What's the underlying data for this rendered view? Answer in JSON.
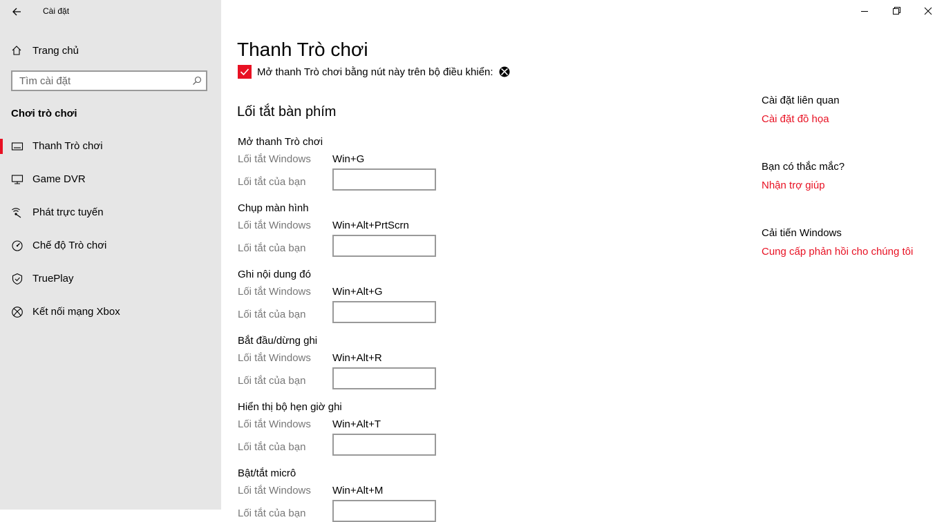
{
  "window": {
    "title": "Cài đặt"
  },
  "sidebar": {
    "home_label": "Trang chủ",
    "search_placeholder": "Tìm cài đặt",
    "section_title": "Chơi trò chơi",
    "items": [
      {
        "label": "Thanh Trò chơi",
        "icon": "game-bar-icon",
        "selected": true
      },
      {
        "label": "Game DVR",
        "icon": "game-dvr-icon"
      },
      {
        "label": "Phát trực tuyến",
        "icon": "broadcast-icon"
      },
      {
        "label": "Chế độ Trò chơi",
        "icon": "game-mode-icon"
      },
      {
        "label": "TruePlay",
        "icon": "trueplay-icon"
      },
      {
        "label": "Kết nối mạng Xbox",
        "icon": "xbox-icon"
      }
    ]
  },
  "main": {
    "title": "Thanh Trò chơi",
    "checkbox_label": "Mở thanh Trò chơi bằng nút này trên bộ điều khiển:",
    "checkbox_checked": true,
    "shortcuts_heading": "Lối tắt bàn phím",
    "windows_shortcut_label": "Lối tắt Windows",
    "your_shortcut_label": "Lối tắt của bạn",
    "shortcuts": [
      {
        "title": "Mở thanh Trò chơi",
        "windows": "Win+G",
        "yours": ""
      },
      {
        "title": "Chụp màn hình",
        "windows": "Win+Alt+PrtScrn",
        "yours": ""
      },
      {
        "title": "Ghi nội dung đó",
        "windows": "Win+Alt+G",
        "yours": ""
      },
      {
        "title": "Bắt đầu/dừng ghi",
        "windows": "Win+Alt+R",
        "yours": ""
      },
      {
        "title": "Hiển thị bộ hẹn giờ ghi",
        "windows": "Win+Alt+T",
        "yours": ""
      },
      {
        "title": "Bật/tắt micrô",
        "windows": "Win+Alt+M",
        "yours": ""
      }
    ]
  },
  "related": {
    "related_heading": "Cài đặt liên quan",
    "graphics_link": "Cài đặt đồ họa",
    "question_heading": "Bạn có thắc mắc?",
    "help_link": "Nhận trợ giúp",
    "improve_heading": "Cải tiến Windows",
    "feedback_link": "Cung cấp phản hồi cho chúng tôi"
  },
  "colors": {
    "accent": "#e81123",
    "sidebar_bg": "#e6e6e6",
    "muted_text": "#777777"
  }
}
